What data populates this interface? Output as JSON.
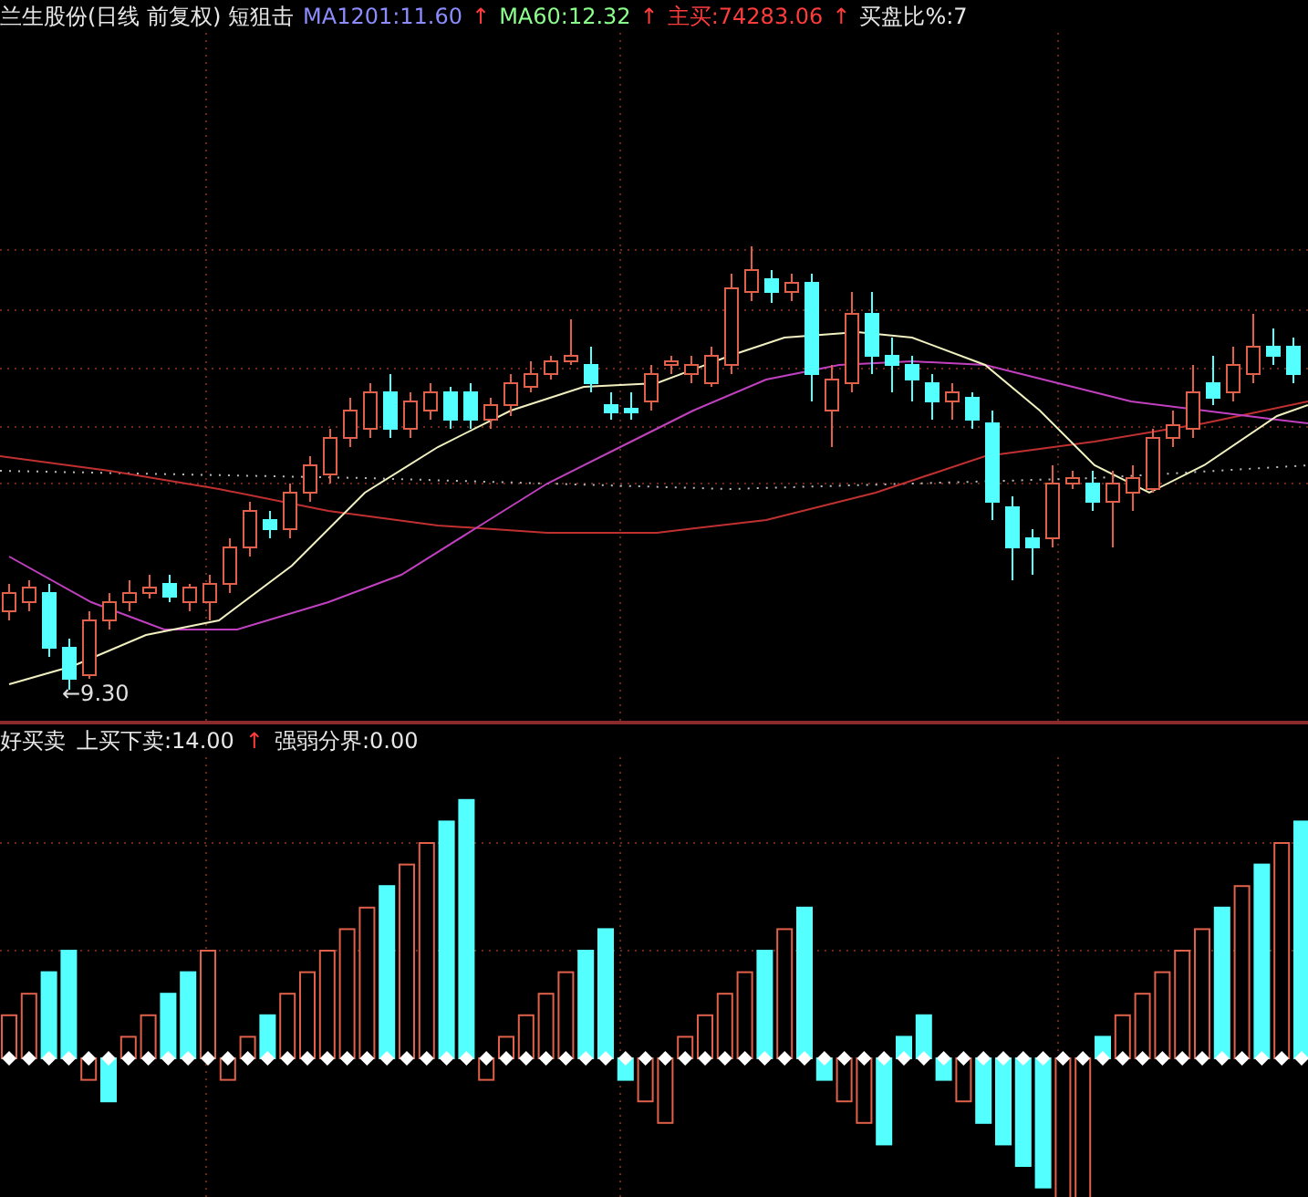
{
  "price_panel": {
    "legend": [
      {
        "text": "兰生股份(日线 前复权) 短狙击",
        "color": "#e8e8e8"
      },
      {
        "text": "MA1201:11.60",
        "color": "#8c8cff"
      },
      {
        "text": "↑",
        "color": "#ff3c3c"
      },
      {
        "text": "MA60:12.32",
        "color": "#8cff8c"
      },
      {
        "text": "↑",
        "color": "#ff3c3c"
      },
      {
        "text": "主买:74283.06",
        "color": "#ff3c3c"
      },
      {
        "text": "↑",
        "color": "#ff3c3c"
      },
      {
        "text": "买盘比%:7",
        "color": "#e8e8e8"
      }
    ],
    "low_label": "←9.30"
  },
  "indicator_panel": {
    "legend": [
      {
        "text": "好买卖",
        "color": "#e8e8e8"
      },
      {
        "text": "上买下卖:14.00",
        "color": "#e8e8e8"
      },
      {
        "text": "↑",
        "color": "#ff3c3c"
      },
      {
        "text": "强弱分界:0.00",
        "color": "#e8e8e8"
      }
    ]
  }
}
